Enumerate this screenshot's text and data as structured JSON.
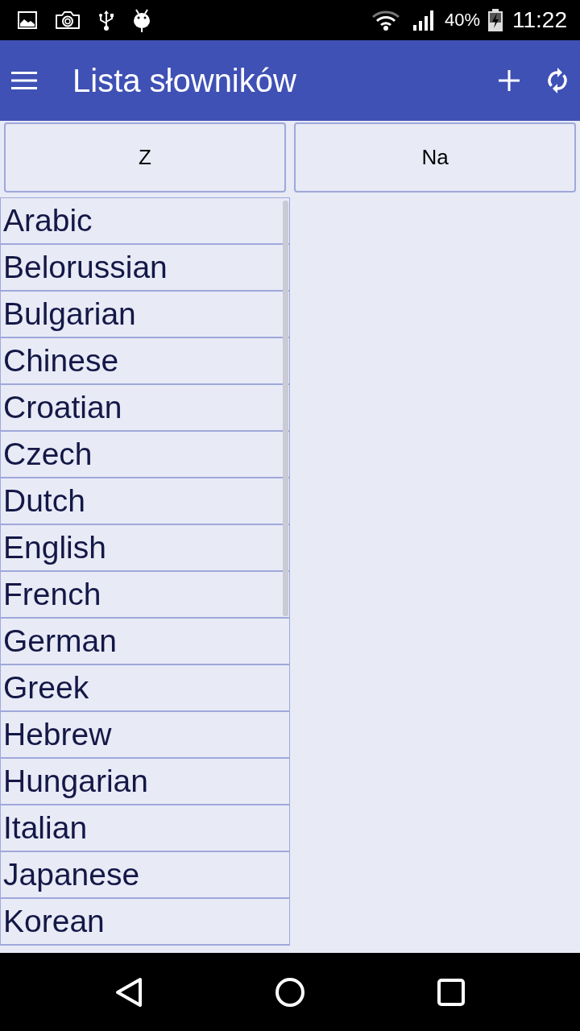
{
  "status_bar": {
    "battery": "40%",
    "time": "11:22"
  },
  "app_bar": {
    "title": "Lista słowników"
  },
  "selectors": [
    {
      "label": "Z"
    },
    {
      "label": "Na"
    }
  ],
  "languages": [
    {
      "name": "Arabic"
    },
    {
      "name": "Belorussian"
    },
    {
      "name": "Bulgarian"
    },
    {
      "name": "Chinese"
    },
    {
      "name": "Croatian"
    },
    {
      "name": "Czech"
    },
    {
      "name": "Dutch"
    },
    {
      "name": "English"
    },
    {
      "name": "French"
    },
    {
      "name": "German"
    },
    {
      "name": "Greek"
    },
    {
      "name": "Hebrew"
    },
    {
      "name": "Hungarian"
    },
    {
      "name": "Italian"
    },
    {
      "name": "Japanese"
    },
    {
      "name": "Korean"
    }
  ]
}
